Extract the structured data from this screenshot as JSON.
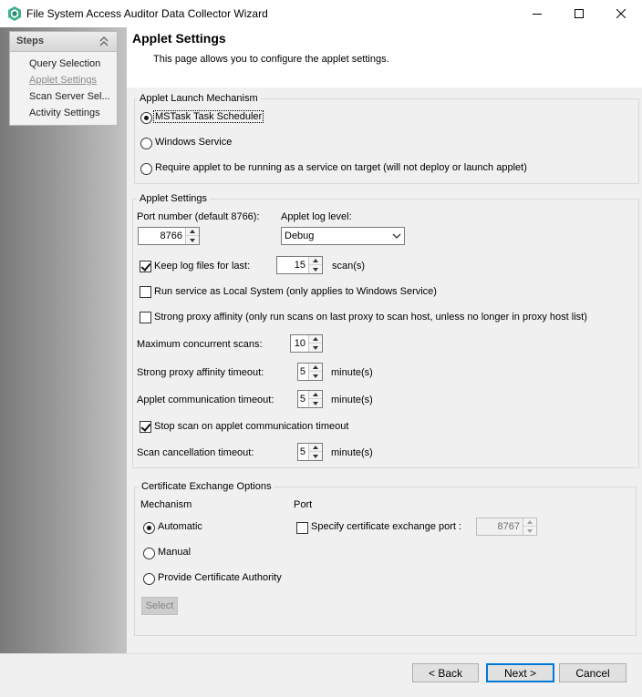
{
  "window": {
    "title": "File System Access Auditor Data Collector Wizard",
    "controls": {
      "minimize": "minimize-icon",
      "maximize": "maximize-icon",
      "close": "close-icon"
    }
  },
  "steps": {
    "title": "Steps",
    "items": [
      {
        "label": "Query Selection",
        "active": false
      },
      {
        "label": "Applet Settings",
        "active": true
      },
      {
        "label": "Scan Server Sel...",
        "active": false
      },
      {
        "label": "Activity Settings",
        "active": false
      }
    ]
  },
  "header": {
    "title": "Applet Settings",
    "subtitle": "This page allows you to configure the applet settings."
  },
  "launch": {
    "legend": "Applet Launch Mechanism",
    "options": [
      {
        "label": "MSTask Task Scheduler",
        "selected": true
      },
      {
        "label": "Windows Service",
        "selected": false
      },
      {
        "label": "Require applet to be running as a service on target (will not deploy or launch applet)",
        "selected": false
      }
    ]
  },
  "settings": {
    "legend": "Applet Settings",
    "port_label": "Port number (default 8766):",
    "port_value": "8766",
    "log_level_label": "Applet log level:",
    "log_level_value": "Debug",
    "keep_logs_label": "Keep log files for last:",
    "keep_logs_checked": true,
    "keep_logs_value": "15",
    "keep_logs_unit": "scan(s)",
    "local_system_label": "Run service as Local System (only applies to Windows Service)",
    "local_system_checked": false,
    "strong_affinity_label": "Strong proxy affinity (only run scans on last proxy to scan host, unless no longer in proxy host list)",
    "strong_affinity_checked": false,
    "max_scans_label": "Maximum concurrent scans:",
    "max_scans_value": "10",
    "affinity_timeout_label": "Strong proxy affinity timeout:",
    "affinity_timeout_value": "5",
    "affinity_timeout_unit": "minute(s)",
    "comm_timeout_label": "Applet communication timeout:",
    "comm_timeout_value": "5",
    "comm_timeout_unit": "minute(s)",
    "stop_scan_label": "Stop scan on applet communication timeout",
    "stop_scan_checked": true,
    "cancel_timeout_label": "Scan cancellation timeout:",
    "cancel_timeout_value": "5",
    "cancel_timeout_unit": "minute(s)"
  },
  "cert": {
    "legend": "Certificate Exchange Options",
    "mechanism_label": "Mechanism",
    "port_label": "Port",
    "mechanisms": [
      {
        "label": "Automatic",
        "selected": true
      },
      {
        "label": "Manual",
        "selected": false
      },
      {
        "label": "Provide Certificate Authority",
        "selected": false
      }
    ],
    "specify_port_label": "Specify certificate exchange port :",
    "specify_port_checked": false,
    "port_value": "8767",
    "select_label": "Select"
  },
  "footer": {
    "back_label": "< Back",
    "next_label": "Next >",
    "cancel_label": "Cancel"
  }
}
